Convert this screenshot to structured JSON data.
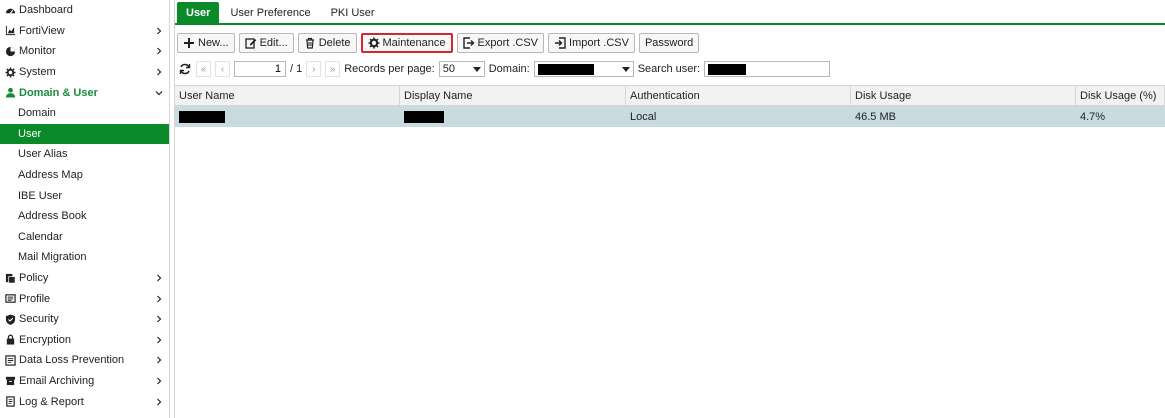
{
  "sidebar": {
    "items": [
      {
        "label": "Dashboard",
        "icon": "dashboard-icon",
        "chevron": false
      },
      {
        "label": "FortiView",
        "icon": "chart-icon",
        "chevron": true
      },
      {
        "label": "Monitor",
        "icon": "pie-icon",
        "chevron": true
      },
      {
        "label": "System",
        "icon": "gear-icon",
        "chevron": true
      },
      {
        "label": "Domain & User",
        "icon": "user-icon",
        "chevron": true,
        "open": true
      },
      {
        "label": "Domain",
        "sub": true
      },
      {
        "label": "User",
        "sub": true,
        "active": true
      },
      {
        "label": "User Alias",
        "sub": true
      },
      {
        "label": "Address Map",
        "sub": true
      },
      {
        "label": "IBE User",
        "sub": true
      },
      {
        "label": "Address Book",
        "sub": true
      },
      {
        "label": "Calendar",
        "sub": true
      },
      {
        "label": "Mail Migration",
        "sub": true
      },
      {
        "label": "Policy",
        "icon": "policy-icon",
        "chevron": true
      },
      {
        "label": "Profile",
        "icon": "profile-icon",
        "chevron": true
      },
      {
        "label": "Security",
        "icon": "shield-icon",
        "chevron": true
      },
      {
        "label": "Encryption",
        "icon": "lock-icon",
        "chevron": true
      },
      {
        "label": "Data Loss Prevention",
        "icon": "dlp-icon",
        "chevron": true
      },
      {
        "label": "Email Archiving",
        "icon": "archive-icon",
        "chevron": true
      },
      {
        "label": "Log & Report",
        "icon": "log-icon",
        "chevron": true
      }
    ]
  },
  "tabs": {
    "user": "User",
    "user_preference": "User Preference",
    "pki_user": "PKI User"
  },
  "toolbar": {
    "new": "New...",
    "edit": "Edit...",
    "delete": "Delete",
    "maintenance": "Maintenance",
    "export": "Export .CSV",
    "import": "Import .CSV",
    "password": "Password"
  },
  "pager": {
    "page": "1",
    "total": "/ 1",
    "records_label": "Records per page:",
    "records_value": "50",
    "domain_label": "Domain:",
    "search_label": "Search user:"
  },
  "grid": {
    "columns": [
      "User Name",
      "Display Name",
      "Authentication",
      "Disk Usage",
      "Disk Usage (%)"
    ],
    "rows": [
      {
        "authentication": "Local",
        "disk_usage": "46.5 MB",
        "disk_usage_pct": "4.7%"
      }
    ]
  },
  "colors": {
    "accent": "#0a8a28",
    "row_selected": "#c8dbe1",
    "highlight_border": "#d4262c"
  }
}
